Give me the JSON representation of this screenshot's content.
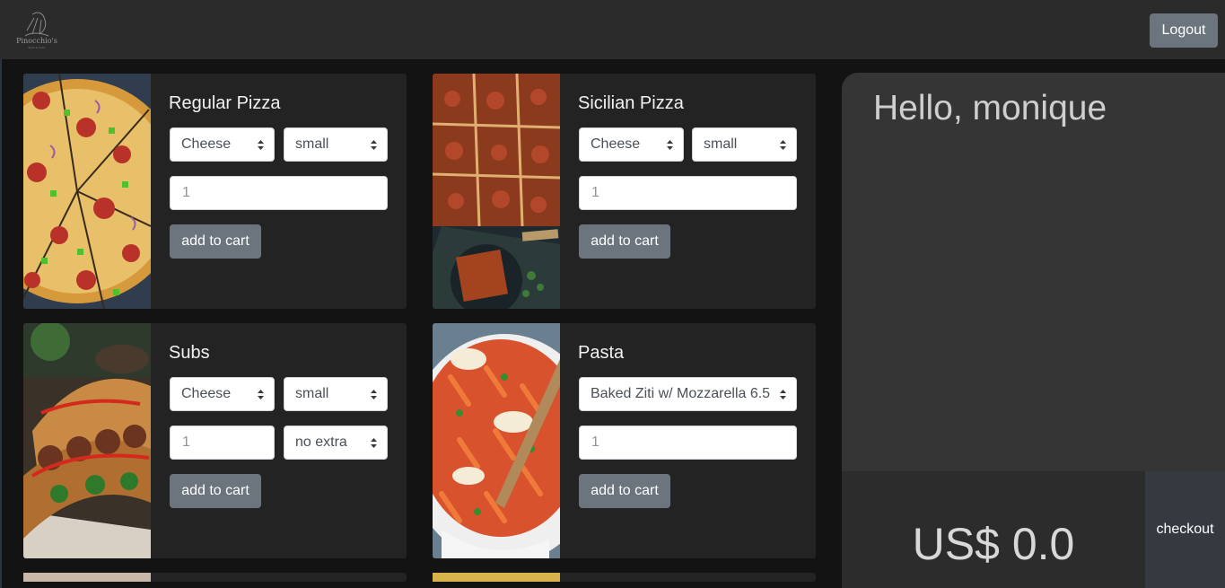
{
  "header": {
    "logo_text": "Pinocchio's",
    "logo_subtext": "Pizza & Subs",
    "logout_label": "Logout"
  },
  "menu": {
    "items": [
      {
        "title": "Regular Pizza",
        "topping": "Cheese",
        "size": "small",
        "quantity": "1",
        "add_label": "add to cart"
      },
      {
        "title": "Sicilian Pizza",
        "topping": "Cheese",
        "size": "small",
        "quantity": "1",
        "add_label": "add to cart"
      },
      {
        "title": "Subs",
        "topping": "Cheese",
        "size": "small",
        "quantity": "1",
        "extra": "no extra",
        "add_label": "add to cart"
      },
      {
        "title": "Pasta",
        "dish": "Baked Ziti w/ Mozzarella 6.5",
        "quantity": "1",
        "add_label": "add to cart"
      }
    ]
  },
  "cart": {
    "greeting": "Hello, monique",
    "total": "US$ 0.0",
    "checkout_label": "checkout"
  },
  "colors": {
    "button_gray": "#6c757d",
    "card_bg": "#232323",
    "page_bg": "#131313",
    "sidebar_bg": "#353535"
  }
}
